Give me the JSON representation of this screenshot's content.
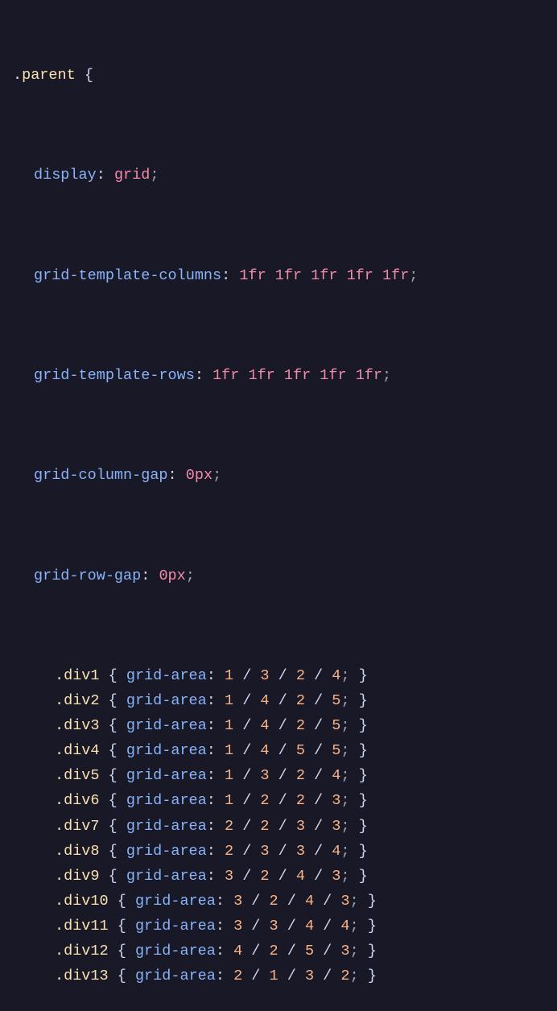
{
  "parent_selector": ".parent",
  "parent_open_brace": "{",
  "decls": [
    {
      "prop": "display",
      "val": "grid",
      "val_type": "val"
    },
    {
      "prop": "grid-template-columns",
      "val": "1fr 1fr 1fr 1fr 1fr",
      "val_type": "val"
    },
    {
      "prop": "grid-template-rows",
      "val": "1fr 1fr 1fr 1fr 1fr",
      "val_type": "val"
    },
    {
      "prop": "grid-column-gap",
      "val": "0px",
      "val_type": "val"
    },
    {
      "prop": "grid-row-gap",
      "val": "0px",
      "val_type": "val"
    }
  ],
  "nested": [
    {
      "sel": ".div1",
      "prop": "grid-area",
      "v": [
        "1",
        "3",
        "2",
        "4"
      ]
    },
    {
      "sel": ".div2",
      "prop": "grid-area",
      "v": [
        "1",
        "4",
        "2",
        "5"
      ]
    },
    {
      "sel": ".div3",
      "prop": "grid-area",
      "v": [
        "1",
        "4",
        "2",
        "5"
      ]
    },
    {
      "sel": ".div4",
      "prop": "grid-area",
      "v": [
        "1",
        "4",
        "5",
        "5"
      ]
    },
    {
      "sel": ".div5",
      "prop": "grid-area",
      "v": [
        "1",
        "3",
        "2",
        "4"
      ]
    },
    {
      "sel": ".div6",
      "prop": "grid-area",
      "v": [
        "1",
        "2",
        "2",
        "3"
      ]
    },
    {
      "sel": ".div7",
      "prop": "grid-area",
      "v": [
        "2",
        "2",
        "3",
        "3"
      ]
    },
    {
      "sel": ".div8",
      "prop": "grid-area",
      "v": [
        "2",
        "3",
        "3",
        "4"
      ]
    },
    {
      "sel": ".div9",
      "prop": "grid-area",
      "v": [
        "3",
        "2",
        "4",
        "3"
      ]
    },
    {
      "sel": ".div10",
      "prop": "grid-area",
      "v": [
        "3",
        "2",
        "4",
        "3"
      ]
    },
    {
      "sel": ".div11",
      "prop": "grid-area",
      "v": [
        "3",
        "3",
        "4",
        "4"
      ]
    },
    {
      "sel": ".div12",
      "prop": "grid-area",
      "v": [
        "4",
        "2",
        "5",
        "3"
      ]
    },
    {
      "sel": ".div13",
      "prop": "grid-area",
      "v": [
        "2",
        "1",
        "3",
        "2"
      ]
    }
  ],
  "sep": " / ",
  "colon": ": ",
  "semi": ";",
  "space": " ",
  "open": "{",
  "close": "}"
}
